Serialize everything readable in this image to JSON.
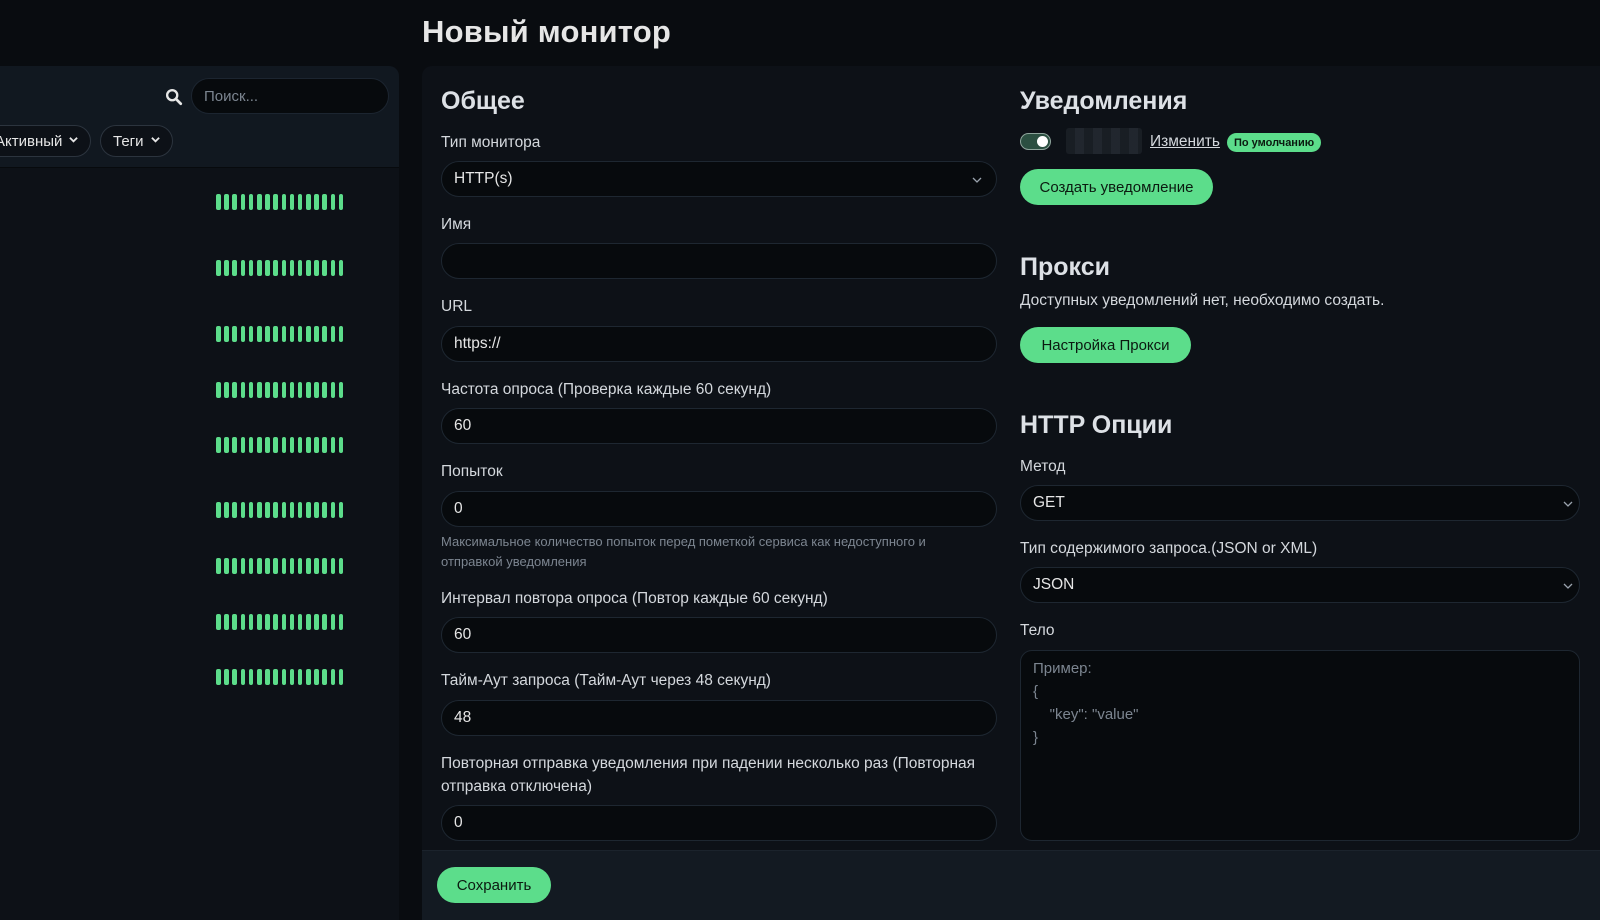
{
  "page": {
    "title": "Новый монитор"
  },
  "sidebar": {
    "search_placeholder": "Поиск...",
    "filter_status_label": "Активный",
    "filter_tags_label": "Теги",
    "monitor_beat_count": 16
  },
  "colors": {
    "accent": "#5cdd8b",
    "background": "#090c10",
    "card": "#0d1117"
  },
  "general": {
    "section_title": "Общее",
    "monitor_type": {
      "label": "Тип монитора",
      "value": "HTTP(s)"
    },
    "name": {
      "label": "Имя",
      "value": ""
    },
    "url": {
      "label": "URL",
      "value": "https://"
    },
    "interval": {
      "label": "Частота опроса (Проверка каждые 60 секунд)",
      "value": "60"
    },
    "retries": {
      "label": "Попыток",
      "value": "0",
      "help": "Максимальное количество попыток перед пометкой сервиса как недоступного и отправкой уведомления"
    },
    "retry_interval": {
      "label": "Интервал повтора опроса (Повтор каждые 60 секунд)",
      "value": "60"
    },
    "timeout": {
      "label": "Тайм-Аут запроса (Тайм-Аут через 48 секунд)",
      "value": "48"
    },
    "resend": {
      "label": "Повторная отправка уведомления при падении несколько раз (Повторная отправка отключена)",
      "value": "0"
    }
  },
  "notifications": {
    "section_title": "Уведомления",
    "edit_link": "Изменить",
    "default_badge": "По умолчанию",
    "create_button": "Создать уведомление"
  },
  "proxy": {
    "section_title": "Прокси",
    "empty_text": "Доступных уведомлений нет, необходимо создать.",
    "setup_button": "Настройка Прокси"
  },
  "http_options": {
    "section_title": "HTTP Опции",
    "method": {
      "label": "Метод",
      "value": "GET"
    },
    "body_encoding": {
      "label": "Тип содержимого запроса.(JSON or XML)",
      "value": "JSON"
    },
    "body": {
      "label": "Тело",
      "placeholder": "Пример:\n{\n    \"key\": \"value\"\n}"
    }
  },
  "footer": {
    "save_button": "Сохранить"
  }
}
